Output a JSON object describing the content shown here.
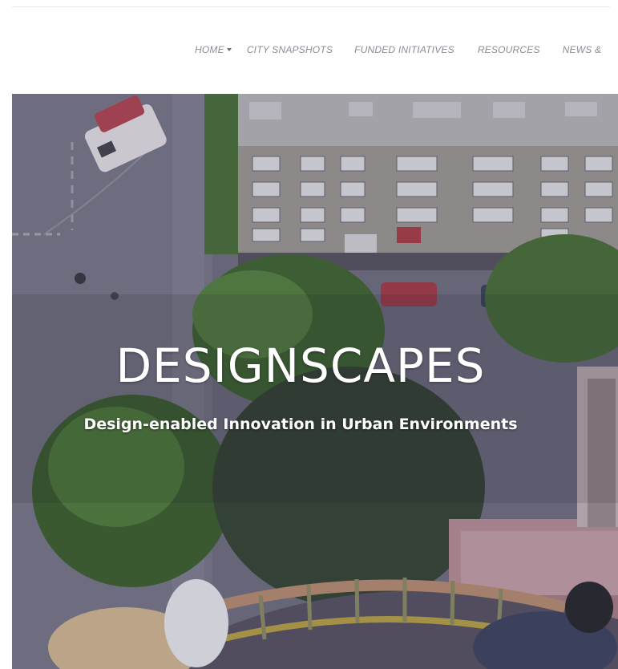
{
  "nav": {
    "items": [
      {
        "label": "HOME",
        "has_dropdown": true
      },
      {
        "label": "CITY SNAPSHOTS"
      },
      {
        "label": "FUNDED INITIATIVES"
      },
      {
        "label": "RESOURCES"
      },
      {
        "label": "NEWS &"
      }
    ]
  },
  "hero": {
    "title": "DESIGNSCAPES",
    "subtitle": "Design-enabled Innovation in Urban Environments"
  },
  "colors": {
    "nav_text": "#8b8b98",
    "hero_overlay": "#5c5a72",
    "hero_text": "#ffffff"
  }
}
